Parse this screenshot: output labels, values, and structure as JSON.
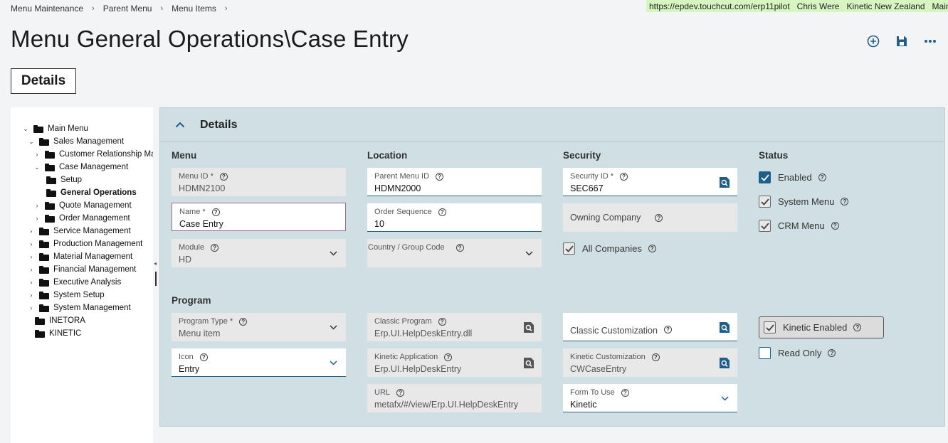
{
  "breadcrumb": [
    "Menu Maintenance",
    "Parent Menu",
    "Menu Items"
  ],
  "env": {
    "url": "https://epdev.touchcut.com/erp11pilot",
    "user": "Chris Were",
    "company": "Kinetic New Zealand",
    "site": "Main Site"
  },
  "page_title": "Menu General Operations\\Case Entry",
  "tab": "Details",
  "tree": {
    "main": "Main Menu",
    "sales": "Sales Management",
    "crm": "Customer Relationship Management",
    "case": "Case Management",
    "setup": "Setup",
    "general": "General Operations",
    "quote": "Quote Management",
    "order": "Order Management",
    "service": "Service Management",
    "production": "Production Management",
    "material": "Material Management",
    "financial": "Financial Management",
    "executive": "Executive Analysis",
    "system_setup": "System Setup",
    "system_mgmt": "System Management",
    "inetora": "INETORA",
    "kinetic": "KINETIC"
  },
  "panel": {
    "title": "Details",
    "sections": {
      "menu": "Menu",
      "location": "Location",
      "security": "Security",
      "status": "Status",
      "program": "Program"
    },
    "fields": {
      "menu_id": {
        "label": "Menu ID",
        "value": "HDMN2100"
      },
      "name": {
        "label": "Name",
        "value": "Case Entry"
      },
      "module": {
        "label": "Module",
        "value": "HD"
      },
      "parent_menu_id": {
        "label": "Parent Menu ID",
        "value": "HDMN2000"
      },
      "order_sequence": {
        "label": "Order Sequence",
        "value": "10"
      },
      "country_group": {
        "label": "Country / Group Code",
        "value": ""
      },
      "security_id": {
        "label": "Security ID",
        "value": "SEC667"
      },
      "owning_company": {
        "label": "Owning Company"
      },
      "program_type": {
        "label": "Program Type",
        "value": "Menu item"
      },
      "icon": {
        "label": "Icon",
        "value": "Entry"
      },
      "classic_program": {
        "label": "Classic Program",
        "value": "Erp.UI.HelpDeskEntry.dll"
      },
      "kinetic_app": {
        "label": "Kinetic Application",
        "value": "Erp.UI.HelpDeskEntry"
      },
      "url": {
        "label": "URL",
        "value": "metafx/#/view/Erp.UI.HelpDeskEntry"
      },
      "classic_custom": {
        "label": "Classic Customization"
      },
      "kinetic_custom": {
        "label": "Kinetic Customization",
        "value": "CWCaseEntry"
      },
      "form_to_use": {
        "label": "Form To Use",
        "value": "Kinetic"
      }
    },
    "checks": {
      "all_companies": "All Companies",
      "enabled": "Enabled",
      "system_menu": "System Menu",
      "crm_menu": "CRM Menu",
      "kinetic_enabled": "Kinetic Enabled",
      "read_only": "Read Only"
    }
  },
  "colors": {
    "accent": "#1d5f8b",
    "panel_bg": "#cfdfe3",
    "env_bar": "#d6f5c0"
  }
}
